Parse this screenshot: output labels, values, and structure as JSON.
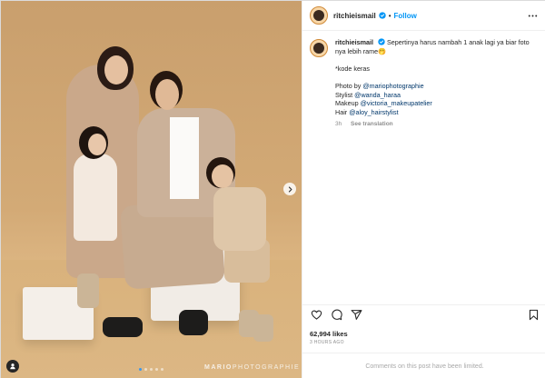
{
  "post": {
    "username": "ritchieismail",
    "follow_label": "Follow",
    "separator": "•"
  },
  "caption": {
    "username": "ritchieismail",
    "text_line1": "Sepertinya harus nambah 1 anak lagi ya biar foto",
    "text_line2": "nya lebih rame",
    "emoji": "🤭",
    "line_kode": "*kode keras",
    "credits": [
      {
        "role": "Photo by ",
        "handle": "@mariophotographie"
      },
      {
        "role": "Stylist ",
        "handle": "@wanda_haraa"
      },
      {
        "role": "Makeup ",
        "handle": "@victoria_makeupatelier"
      },
      {
        "role": "Hair ",
        "handle": "@aloy_hairstylist"
      }
    ],
    "age": "3h",
    "see_translation": "See translation"
  },
  "photo": {
    "watermark_bold": "MARIO",
    "watermark_light": "PHOTOGRAPHIE",
    "carousel_count": 5,
    "carousel_active": 1
  },
  "stats": {
    "likes": "62,994 likes",
    "timestamp": "3 HOURS AGO"
  },
  "comments": {
    "limited_text": "Comments on this post have been limited."
  },
  "icons": {
    "verified": "verified-badge-icon",
    "more": "more-options-icon",
    "like": "heart-icon",
    "comment": "comment-icon",
    "share": "share-icon",
    "save": "bookmark-icon",
    "next": "chevron-right-icon",
    "user": "user-icon"
  },
  "colors": {
    "accent": "#0095f6",
    "link": "#00376b",
    "muted": "#8e8e8e",
    "backdrop": "#d3aa76"
  }
}
